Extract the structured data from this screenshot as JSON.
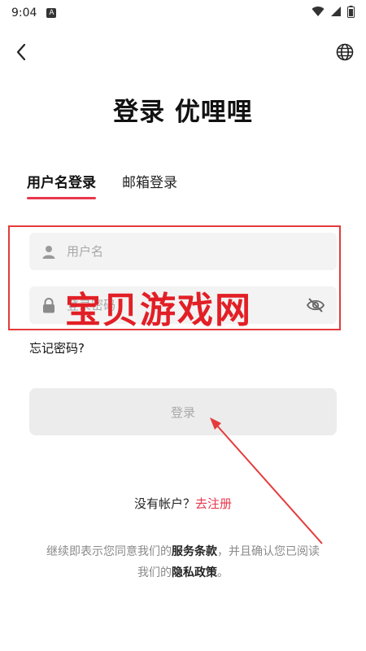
{
  "status_bar": {
    "time": "9:04",
    "badge": "A"
  },
  "title": "登录 优哩哩",
  "tabs": [
    {
      "label": "用户名登录",
      "active": true
    },
    {
      "label": "邮箱登录",
      "active": false
    }
  ],
  "username_field": {
    "placeholder": "用户名",
    "icon": "user-icon"
  },
  "password_field": {
    "placeholder": "登录密码",
    "icon": "lock-icon",
    "toggle_icon": "eye-off-icon"
  },
  "forgot_password": "忘记密码?",
  "login_button": "登录",
  "signup": {
    "prompt": "没有帐户？",
    "link": "去注册"
  },
  "terms": {
    "part1": "继续即表示您同意我们的",
    "service_terms": "服务条款",
    "part2": "，并且确认您已阅读",
    "part3": "我们的",
    "privacy_policy": "隐私政策",
    "part4": "。"
  },
  "watermark": {
    "text": "宝贝游戏网"
  },
  "colors": {
    "accent": "#e8374d",
    "field_bg": "#f3f3f3",
    "button_bg": "#ececec",
    "watermark": "#e21f26"
  }
}
